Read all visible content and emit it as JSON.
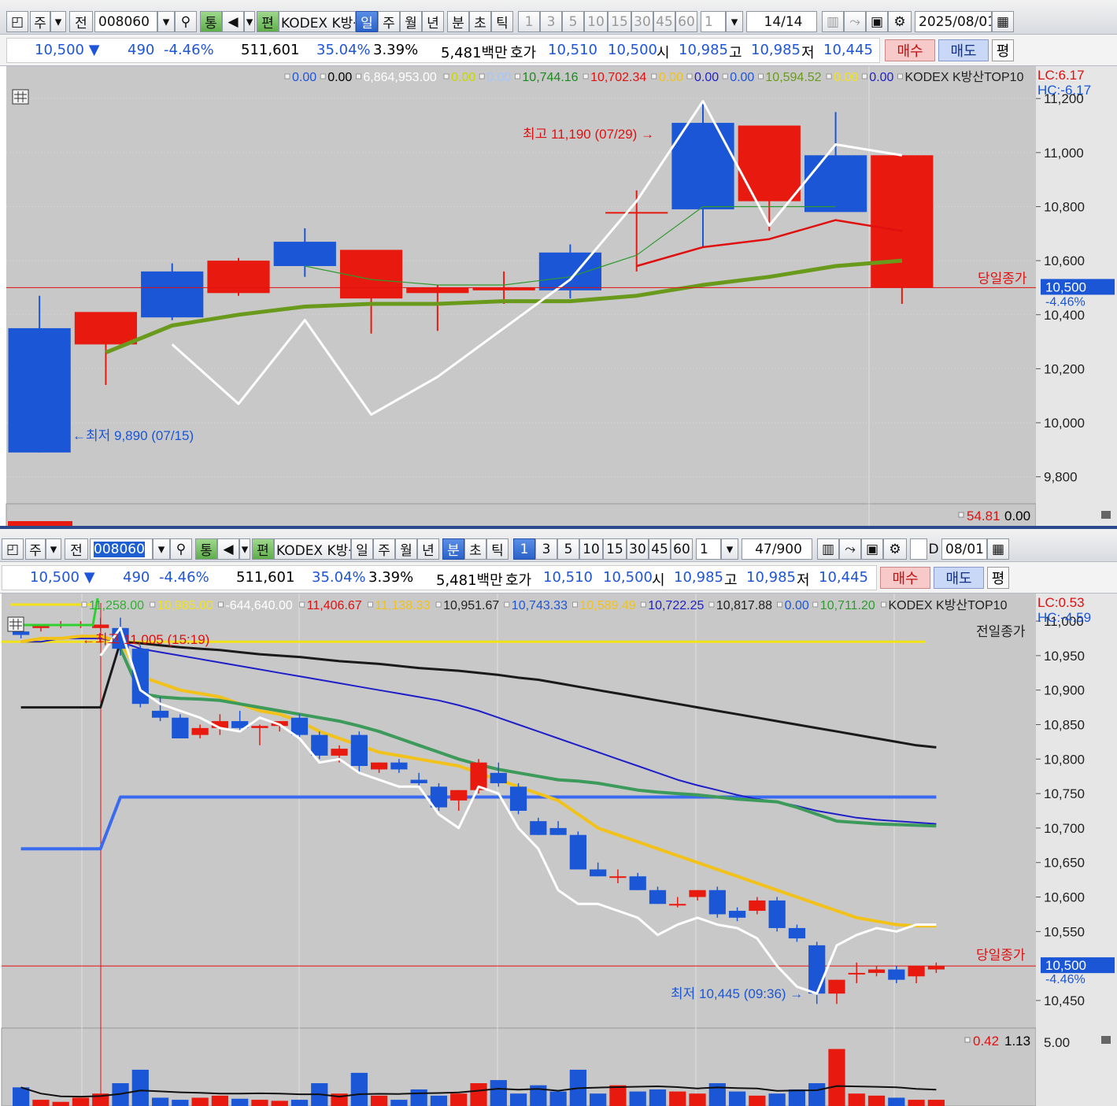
{
  "colors": {
    "up": "#e8190f",
    "down": "#1a56d6",
    "ma_white": "#ffffff",
    "ma_green": "#6a9a1c",
    "ma_red": "#e01010",
    "ma_thin_green": "#2f9a2f",
    "ma_yellow": "#f2c21a",
    "ma_navy": "#1f1fc8",
    "ma_black": "#1a1a1a",
    "ma_teal": "#3c9a5a",
    "chart_bg": "#c8c8c8",
    "axis_bg": "#e6e6e6"
  },
  "toolbar": {
    "type_label": "주",
    "prev_label": "전",
    "code": "008060",
    "name_label": "KODEX K방산",
    "magnify_label": "통",
    "edit_label": "편",
    "daily": "일",
    "weekly": "주",
    "monthly": "월",
    "yearly": "년",
    "minute": "분",
    "second": "초",
    "tick": "틱",
    "intervals": [
      "1",
      "3",
      "5",
      "10",
      "15",
      "30",
      "45",
      "60"
    ],
    "count_value": "1"
  },
  "top": {
    "count": "14",
    "count_total": "/14",
    "date": "2025/08/01",
    "quote": {
      "price": "10,500 ▼",
      "change": "490",
      "rate": "-4.46%",
      "volume": "511,601",
      "vol_ratio": "35.04%",
      "turnover": "3.39%",
      "amount": "5,481백만",
      "hoga_label": "호가",
      "ask": "10,510",
      "bid": "10,500",
      "open_label": "시",
      "open": "10,985",
      "high_label": "고",
      "high": "10,985",
      "low_label": "저",
      "low": "10,445",
      "buy": "매수",
      "sell": "매도",
      "even": "평"
    },
    "legend": [
      {
        "t": "0.00",
        "c": "#1f55d8"
      },
      {
        "t": "0.00",
        "c": "#000"
      },
      {
        "t": "6,864,953.00",
        "c": "#ffffff"
      },
      {
        "t": "0.00",
        "c": "#c8d800"
      },
      {
        "t": "0.00",
        "c": "#a0c8ff"
      },
      {
        "t": "10,744.16",
        "c": "#1a8a1a"
      },
      {
        "t": "10,702.34",
        "c": "#e01010"
      },
      {
        "t": "0.00",
        "c": "#f2c21a"
      },
      {
        "t": "0.00",
        "c": "#1f1fc8"
      },
      {
        "t": "0.00",
        "c": "#1f55d8"
      },
      {
        "t": "10,594.52",
        "c": "#6a9a1c"
      },
      {
        "t": "0.00",
        "c": "#f2e21a"
      },
      {
        "t": "0.00",
        "c": "#1f1fc8"
      },
      {
        "t": "KODEX K방산TOP10",
        "c": "#222"
      }
    ],
    "lc": "LC:6.17",
    "hc": "HC:-6.17",
    "y_ticks": [
      "11,200",
      "11,000",
      "10,800",
      "10,600",
      "10,400",
      "10,200",
      "10,000",
      "9,800"
    ],
    "today_close_label": "당일종가",
    "last_price": "10,500",
    "last_rate": "-4.46%",
    "high_note": "최고 11,190 (07/29) →",
    "low_note": "←최저 9,890 (07/15)",
    "sub_legend": [
      {
        "t": "54.81",
        "c": "#e01010"
      },
      {
        "t": "0.00",
        "c": "#000"
      }
    ]
  },
  "bottom": {
    "count": "47",
    "count_total": "/900",
    "date": "08/01",
    "d_label": "D",
    "quote": {
      "price": "10,500 ▼",
      "change": "490",
      "rate": "-4.46%",
      "volume": "511,601",
      "vol_ratio": "35.04%",
      "turnover": "3.39%",
      "amount": "5,481백만",
      "hoga_label": "호가",
      "ask": "10,510",
      "bid": "10,500",
      "open_label": "시",
      "open": "10,985",
      "high_label": "고",
      "high": "10,985",
      "low_label": "저",
      "low": "10,445",
      "buy": "매수",
      "sell": "매도",
      "even": "평"
    },
    "legend": [
      {
        "t": "11,258.00",
        "c": "#2fb02f"
      },
      {
        "t": "10,985.00",
        "c": "#f2e21a"
      },
      {
        "t": "-644,640.00",
        "c": "#ffffff"
      },
      {
        "t": "11,406.67",
        "c": "#e01010"
      },
      {
        "t": "11,138.33",
        "c": "#f2c21a"
      },
      {
        "t": "10,951.67",
        "c": "#222"
      },
      {
        "t": "10,743.33",
        "c": "#1f55d8"
      },
      {
        "t": "10,589.49",
        "c": "#f2c21a"
      },
      {
        "t": "10,722.25",
        "c": "#1f1fc8"
      },
      {
        "t": "10,817.88",
        "c": "#222"
      },
      {
        "t": "0.00",
        "c": "#1f55d8"
      },
      {
        "t": "10,711.20",
        "c": "#2f9a2f"
      },
      {
        "t": "KODEX K방산TOP10",
        "c": "#222"
      }
    ],
    "lc": "LC:0.53",
    "hc": "HC:-4.59",
    "y_ticks": [
      "11,000",
      "10,950",
      "10,900",
      "10,850",
      "10,800",
      "10,750",
      "10,700",
      "10,650",
      "10,600",
      "10,550",
      "10,450"
    ],
    "prev_close_label": "전일종가",
    "today_close_label": "당일종가",
    "last_price": "10,500",
    "last_rate": "-4.46%",
    "high_note": "←최고 11,005 (15:19)",
    "low_note": "최저 10,445 (09:36) →",
    "sub_legend": [
      {
        "t": "0.42",
        "c": "#e01010"
      },
      {
        "t": "1.13",
        "c": "#000"
      }
    ],
    "sub_tick": "5.00"
  },
  "chart_data": [
    {
      "type": "candlestick",
      "title": "KODEX K방산TOP10",
      "ylim": [
        9700,
        11320
      ],
      "candles": [
        {
          "o": 10350,
          "h": 10470,
          "l": 9890,
          "c": 9890
        },
        {
          "o": 10290,
          "h": 10330,
          "l": 10140,
          "c": 10410
        },
        {
          "o": 10560,
          "h": 10590,
          "l": 10380,
          "c": 10390
        },
        {
          "o": 10480,
          "h": 10610,
          "l": 10470,
          "c": 10600
        },
        {
          "o": 10670,
          "h": 10720,
          "l": 10540,
          "c": 10580
        },
        {
          "o": 10460,
          "h": 10540,
          "l": 10330,
          "c": 10640
        },
        {
          "o": 10480,
          "h": 10510,
          "l": 10340,
          "c": 10500
        },
        {
          "o": 10490,
          "h": 10560,
          "l": 10440,
          "c": 10500
        },
        {
          "o": 10630,
          "h": 10660,
          "l": 10460,
          "c": 10490
        },
        {
          "o": 10780,
          "h": 10860,
          "l": 10560,
          "c": 10780
        },
        {
          "o": 11110,
          "h": 11190,
          "l": 10650,
          "c": 10790
        },
        {
          "o": 10820,
          "h": 11100,
          "l": 10710,
          "c": 11100
        },
        {
          "o": 10990,
          "h": 11150,
          "l": 10790,
          "c": 10780
        },
        {
          "o": 10500,
          "h": 10990,
          "l": 10440,
          "c": 10990
        }
      ],
      "ma_white": [
        9830,
        null,
        10290,
        10070,
        10380,
        10030,
        10170,
        10350,
        10530,
        10820,
        11190,
        10730,
        11030,
        10990
      ],
      "ma_green": [
        null,
        10260,
        10360,
        10400,
        10430,
        10440,
        10440,
        10450,
        10450,
        10470,
        10510,
        10540,
        10580,
        10600
      ],
      "ma_red": [
        null,
        null,
        null,
        null,
        null,
        null,
        null,
        null,
        null,
        10580,
        10650,
        10680,
        10750,
        10710
      ],
      "ma_thin": [
        null,
        null,
        null,
        null,
        10580,
        10530,
        10510,
        10510,
        10540,
        10620,
        10800,
        10800,
        10800,
        null
      ],
      "today_close": 10500
    },
    {
      "type": "candlestick",
      "title": "KODEX K방산TOP10",
      "ylim": [
        10410,
        11040
      ],
      "candles": [
        {
          "o": 10985,
          "h": 10990,
          "l": 10975,
          "c": 10980
        },
        {
          "o": 10990,
          "h": 10995,
          "l": 10985,
          "c": 10995
        },
        {
          "o": 10995,
          "h": 11000,
          "l": 10990,
          "c": 10995
        },
        {
          "o": 10995,
          "h": 11000,
          "l": 10990,
          "c": 10995
        },
        {
          "o": 10990,
          "h": 11005,
          "l": 10985,
          "c": 10995
        },
        {
          "o": 10990,
          "h": 11005,
          "l": 10950,
          "c": 10960
        },
        {
          "o": 10960,
          "h": 10965,
          "l": 10875,
          "c": 10880
        },
        {
          "o": 10870,
          "h": 10890,
          "l": 10855,
          "c": 10860
        },
        {
          "o": 10860,
          "h": 10865,
          "l": 10830,
          "c": 10830
        },
        {
          "o": 10835,
          "h": 10850,
          "l": 10830,
          "c": 10845
        },
        {
          "o": 10845,
          "h": 10865,
          "l": 10835,
          "c": 10855
        },
        {
          "o": 10855,
          "h": 10870,
          "l": 10840,
          "c": 10845
        },
        {
          "o": 10845,
          "h": 10850,
          "l": 10820,
          "c": 10848
        },
        {
          "o": 10848,
          "h": 10855,
          "l": 10840,
          "c": 10855
        },
        {
          "o": 10860,
          "h": 10865,
          "l": 10830,
          "c": 10835
        },
        {
          "o": 10835,
          "h": 10840,
          "l": 10800,
          "c": 10805
        },
        {
          "o": 10805,
          "h": 10820,
          "l": 10795,
          "c": 10815
        },
        {
          "o": 10835,
          "h": 10840,
          "l": 10780,
          "c": 10790
        },
        {
          "o": 10785,
          "h": 10795,
          "l": 10780,
          "c": 10795
        },
        {
          "o": 10795,
          "h": 10800,
          "l": 10780,
          "c": 10785
        },
        {
          "o": 10770,
          "h": 10780,
          "l": 10760,
          "c": 10765
        },
        {
          "o": 10760,
          "h": 10765,
          "l": 10725,
          "c": 10730
        },
        {
          "o": 10740,
          "h": 10755,
          "l": 10725,
          "c": 10755
        },
        {
          "o": 10755,
          "h": 10800,
          "l": 10750,
          "c": 10795
        },
        {
          "o": 10780,
          "h": 10795,
          "l": 10760,
          "c": 10765
        },
        {
          "o": 10760,
          "h": 10765,
          "l": 10720,
          "c": 10725
        },
        {
          "o": 10710,
          "h": 10715,
          "l": 10690,
          "c": 10690
        },
        {
          "o": 10700,
          "h": 10710,
          "l": 10690,
          "c": 10690
        },
        {
          "o": 10690,
          "h": 10695,
          "l": 10640,
          "c": 10640
        },
        {
          "o": 10640,
          "h": 10650,
          "l": 10630,
          "c": 10630
        },
        {
          "o": 10630,
          "h": 10640,
          "l": 10620,
          "c": 10630
        },
        {
          "o": 10630,
          "h": 10635,
          "l": 10610,
          "c": 10610
        },
        {
          "o": 10610,
          "h": 10615,
          "l": 10590,
          "c": 10590
        },
        {
          "o": 10590,
          "h": 10600,
          "l": 10585,
          "c": 10590
        },
        {
          "o": 10600,
          "h": 10610,
          "l": 10595,
          "c": 10610
        },
        {
          "o": 10610,
          "h": 10615,
          "l": 10570,
          "c": 10575
        },
        {
          "o": 10580,
          "h": 10585,
          "l": 10565,
          "c": 10570
        },
        {
          "o": 10580,
          "h": 10600,
          "l": 10575,
          "c": 10595
        },
        {
          "o": 10595,
          "h": 10600,
          "l": 10550,
          "c": 10555
        },
        {
          "o": 10555,
          "h": 10560,
          "l": 10535,
          "c": 10540
        },
        {
          "o": 10530,
          "h": 10535,
          "l": 10445,
          "c": 10460
        },
        {
          "o": 10460,
          "h": 10480,
          "l": 10445,
          "c": 10480
        },
        {
          "o": 10490,
          "h": 10505,
          "l": 10475,
          "c": 10490
        },
        {
          "o": 10490,
          "h": 10500,
          "l": 10485,
          "c": 10495
        },
        {
          "o": 10495,
          "h": 10500,
          "l": 10475,
          "c": 10480
        },
        {
          "o": 10485,
          "h": 10500,
          "l": 10475,
          "c": 10500
        },
        {
          "o": 10495,
          "h": 10505,
          "l": 10490,
          "c": 10500
        }
      ],
      "volume": [
        18,
        6,
        4,
        8,
        12,
        22,
        35,
        8,
        6,
        8,
        10,
        7,
        6,
        5,
        6,
        22,
        12,
        32,
        10,
        6,
        16,
        10,
        12,
        22,
        25,
        12,
        20,
        14,
        35,
        12,
        20,
        14,
        16,
        14,
        12,
        22,
        14,
        10,
        12,
        16,
        22,
        55,
        12,
        10,
        8,
        6,
        6
      ],
      "ma_white": [
        null,
        null,
        null,
        null,
        10950,
        10990,
        10900,
        10880,
        10870,
        10860,
        10845,
        10840,
        10860,
        10850,
        10830,
        10795,
        10800,
        10780,
        10770,
        10760,
        10760,
        10720,
        10700,
        10760,
        10750,
        10700,
        10670,
        10610,
        10590,
        10590,
        10580,
        10570,
        10545,
        10560,
        10570,
        10560,
        10555,
        10540,
        10500,
        10470,
        10460,
        10530,
        10545,
        10555,
        10550,
        10560,
        10560
      ],
      "ma_yellow": [
        10970,
        10975,
        10975,
        10978,
        10978,
        10970,
        10920,
        10910,
        10900,
        10895,
        10890,
        10880,
        10870,
        10865,
        10855,
        10840,
        10830,
        10820,
        10810,
        10805,
        10800,
        10795,
        10790,
        10780,
        10770,
        10760,
        10750,
        10740,
        10720,
        10700,
        10690,
        10680,
        10670,
        10660,
        10650,
        10640,
        10630,
        10620,
        10610,
        10600,
        10590,
        10580,
        10570,
        10565,
        10560,
        10558,
        10558
      ],
      "ma_navy": [
        10970,
        10970,
        10975,
        10975,
        10975,
        10970,
        10960,
        10955,
        10950,
        10945,
        10940,
        10935,
        10930,
        10925,
        10920,
        10915,
        10910,
        10905,
        10900,
        10895,
        10890,
        10885,
        10878,
        10870,
        10860,
        10850,
        10840,
        10830,
        10820,
        10810,
        10800,
        10790,
        10780,
        10770,
        10762,
        10755,
        10748,
        10742,
        10738,
        10732,
        10725,
        10720,
        10715,
        10712,
        10710,
        10708,
        10706
      ],
      "ma_black": [
        10875,
        10875,
        10875,
        10875,
        10875,
        10970,
        10968,
        10965,
        10962,
        10960,
        10958,
        10955,
        10952,
        10950,
        10948,
        10945,
        10942,
        10940,
        10938,
        10935,
        10932,
        10930,
        10928,
        10925,
        10922,
        10918,
        10915,
        10910,
        10905,
        10900,
        10895,
        10890,
        10885,
        10880,
        10875,
        10870,
        10865,
        10860,
        10855,
        10850,
        10845,
        10840,
        10835,
        10830,
        10825,
        10820,
        10817
      ],
      "ma_green": [
        null,
        null,
        null,
        null,
        null,
        10960,
        10895,
        10890,
        10888,
        10887,
        10885,
        10880,
        10875,
        10870,
        10865,
        10860,
        10855,
        10848,
        10840,
        10830,
        10820,
        10810,
        10800,
        10792,
        10785,
        10780,
        10775,
        10770,
        10768,
        10765,
        10760,
        10755,
        10752,
        10750,
        10748,
        10745,
        10742,
        10740,
        10738,
        10730,
        10720,
        10710,
        10708,
        10706,
        10705,
        10704,
        10703
      ],
      "ma_blue": [
        10670,
        10670,
        10670,
        10670,
        10670,
        10745,
        10745,
        10745,
        10745,
        10745,
        10745,
        10745,
        10745,
        10745,
        10745,
        10745,
        10745,
        10745,
        10745,
        10745,
        10745,
        10745,
        10745,
        10745,
        10745,
        10745,
        10745,
        10745,
        10745,
        10745,
        10745,
        10745,
        10745,
        10745,
        10745,
        10745,
        10745,
        10745,
        10745,
        10745,
        10745,
        10745,
        10745,
        10745,
        10745,
        10745,
        10745
      ],
      "prev_close": 10985,
      "today_close": 10500
    }
  ]
}
